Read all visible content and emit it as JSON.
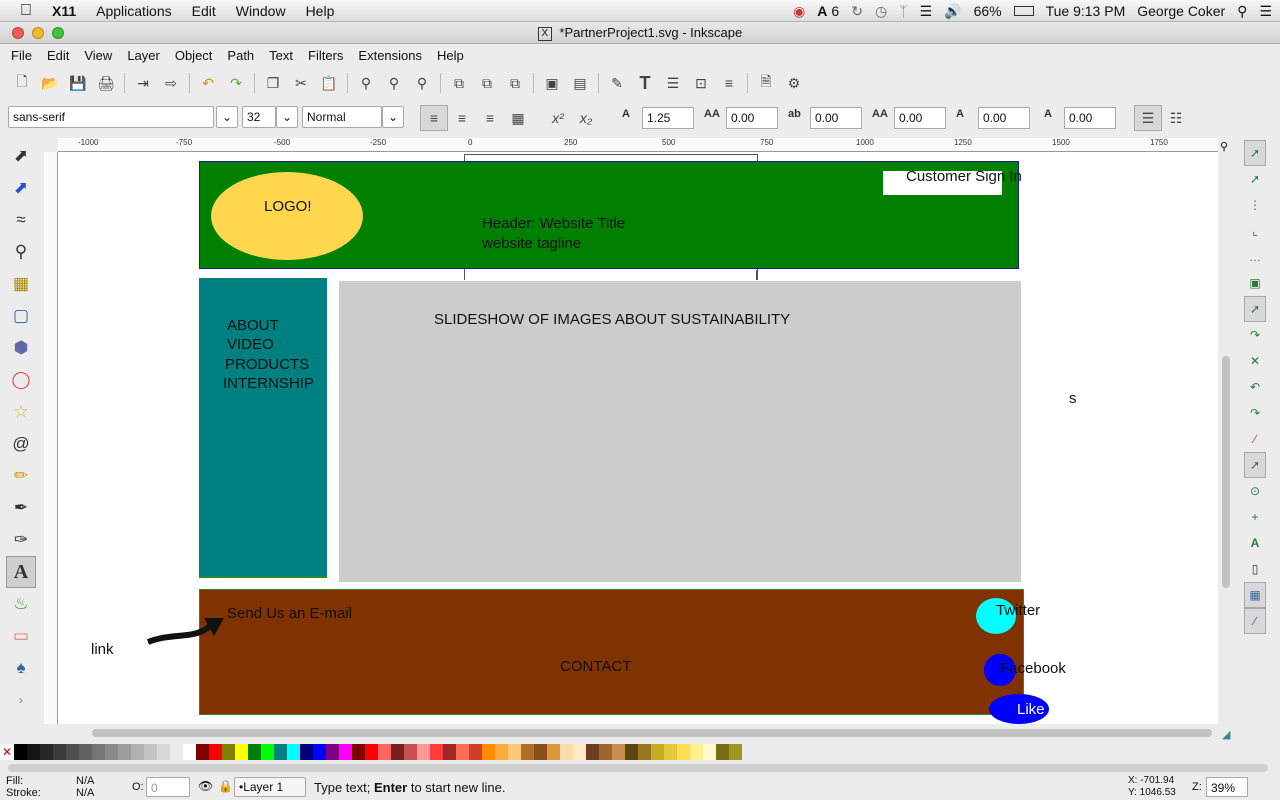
{
  "os_menu": {
    "app": "X11",
    "items": [
      "Applications",
      "Edit",
      "Window",
      "Help"
    ],
    "status": {
      "adobe_count": "6",
      "battery": "66%",
      "time": "Tue 9:13 PM",
      "user": "George Coker"
    }
  },
  "window_title": "*PartnerProject1.svg - Inkscape",
  "menu": [
    "File",
    "Edit",
    "View",
    "Layer",
    "Object",
    "Path",
    "Text",
    "Filters",
    "Extensions",
    "Help"
  ],
  "text_toolbar": {
    "font_family": "sans-serif",
    "font_size": "32",
    "font_style": "Normal",
    "line_spacing": "1.25",
    "letter_spacing": "0.00",
    "word_spacing": "0.00",
    "horiz_kern": "0.00",
    "vert_kern": "0.00",
    "rotation": "0.00"
  },
  "ruler_labels": [
    "-1000",
    "-750",
    "-500",
    "-250",
    "0",
    "250",
    "500",
    "750",
    "1000",
    "1250",
    "1500",
    "1750"
  ],
  "canvas": {
    "logo": "LOGO!",
    "customer_sign_in": "Customer Sign In",
    "header_title": "Header: Website Title",
    "header_tagline": "website tagline",
    "nav_items": [
      "ABOUT",
      "VIDEO",
      "PRODUCTS",
      "INTERNSHIP"
    ],
    "slideshow": "SLIDESHOW OF IMAGES ABOUT SUSTAINABILITY",
    "stray_s": "s",
    "email": "Send Us an E-mail",
    "contact": "CONTACT",
    "link": "link",
    "twitter": "Twitter",
    "facebook": "Facebook",
    "like": "Like",
    "colors": {
      "header": "#008000",
      "logo": "#ffd74f",
      "nav": "#008080",
      "slideshow": "#cccccc",
      "footer": "#803300",
      "twitter": "#00ffff",
      "facebook": "#0000ff"
    }
  },
  "status": {
    "fill_label": "Fill:",
    "fill_value": "N/A",
    "stroke_label": "Stroke:",
    "stroke_value": "N/A",
    "opacity_label": "O:",
    "opacity_value": "0",
    "layer": "•Layer 1",
    "message_prefix": "Type text; ",
    "message_key": "Enter",
    "message_suffix": " to start new line.",
    "x": "X: -701.94",
    "y": "Y: 1046.53",
    "zoom_label": "Z:",
    "zoom": "39%"
  }
}
